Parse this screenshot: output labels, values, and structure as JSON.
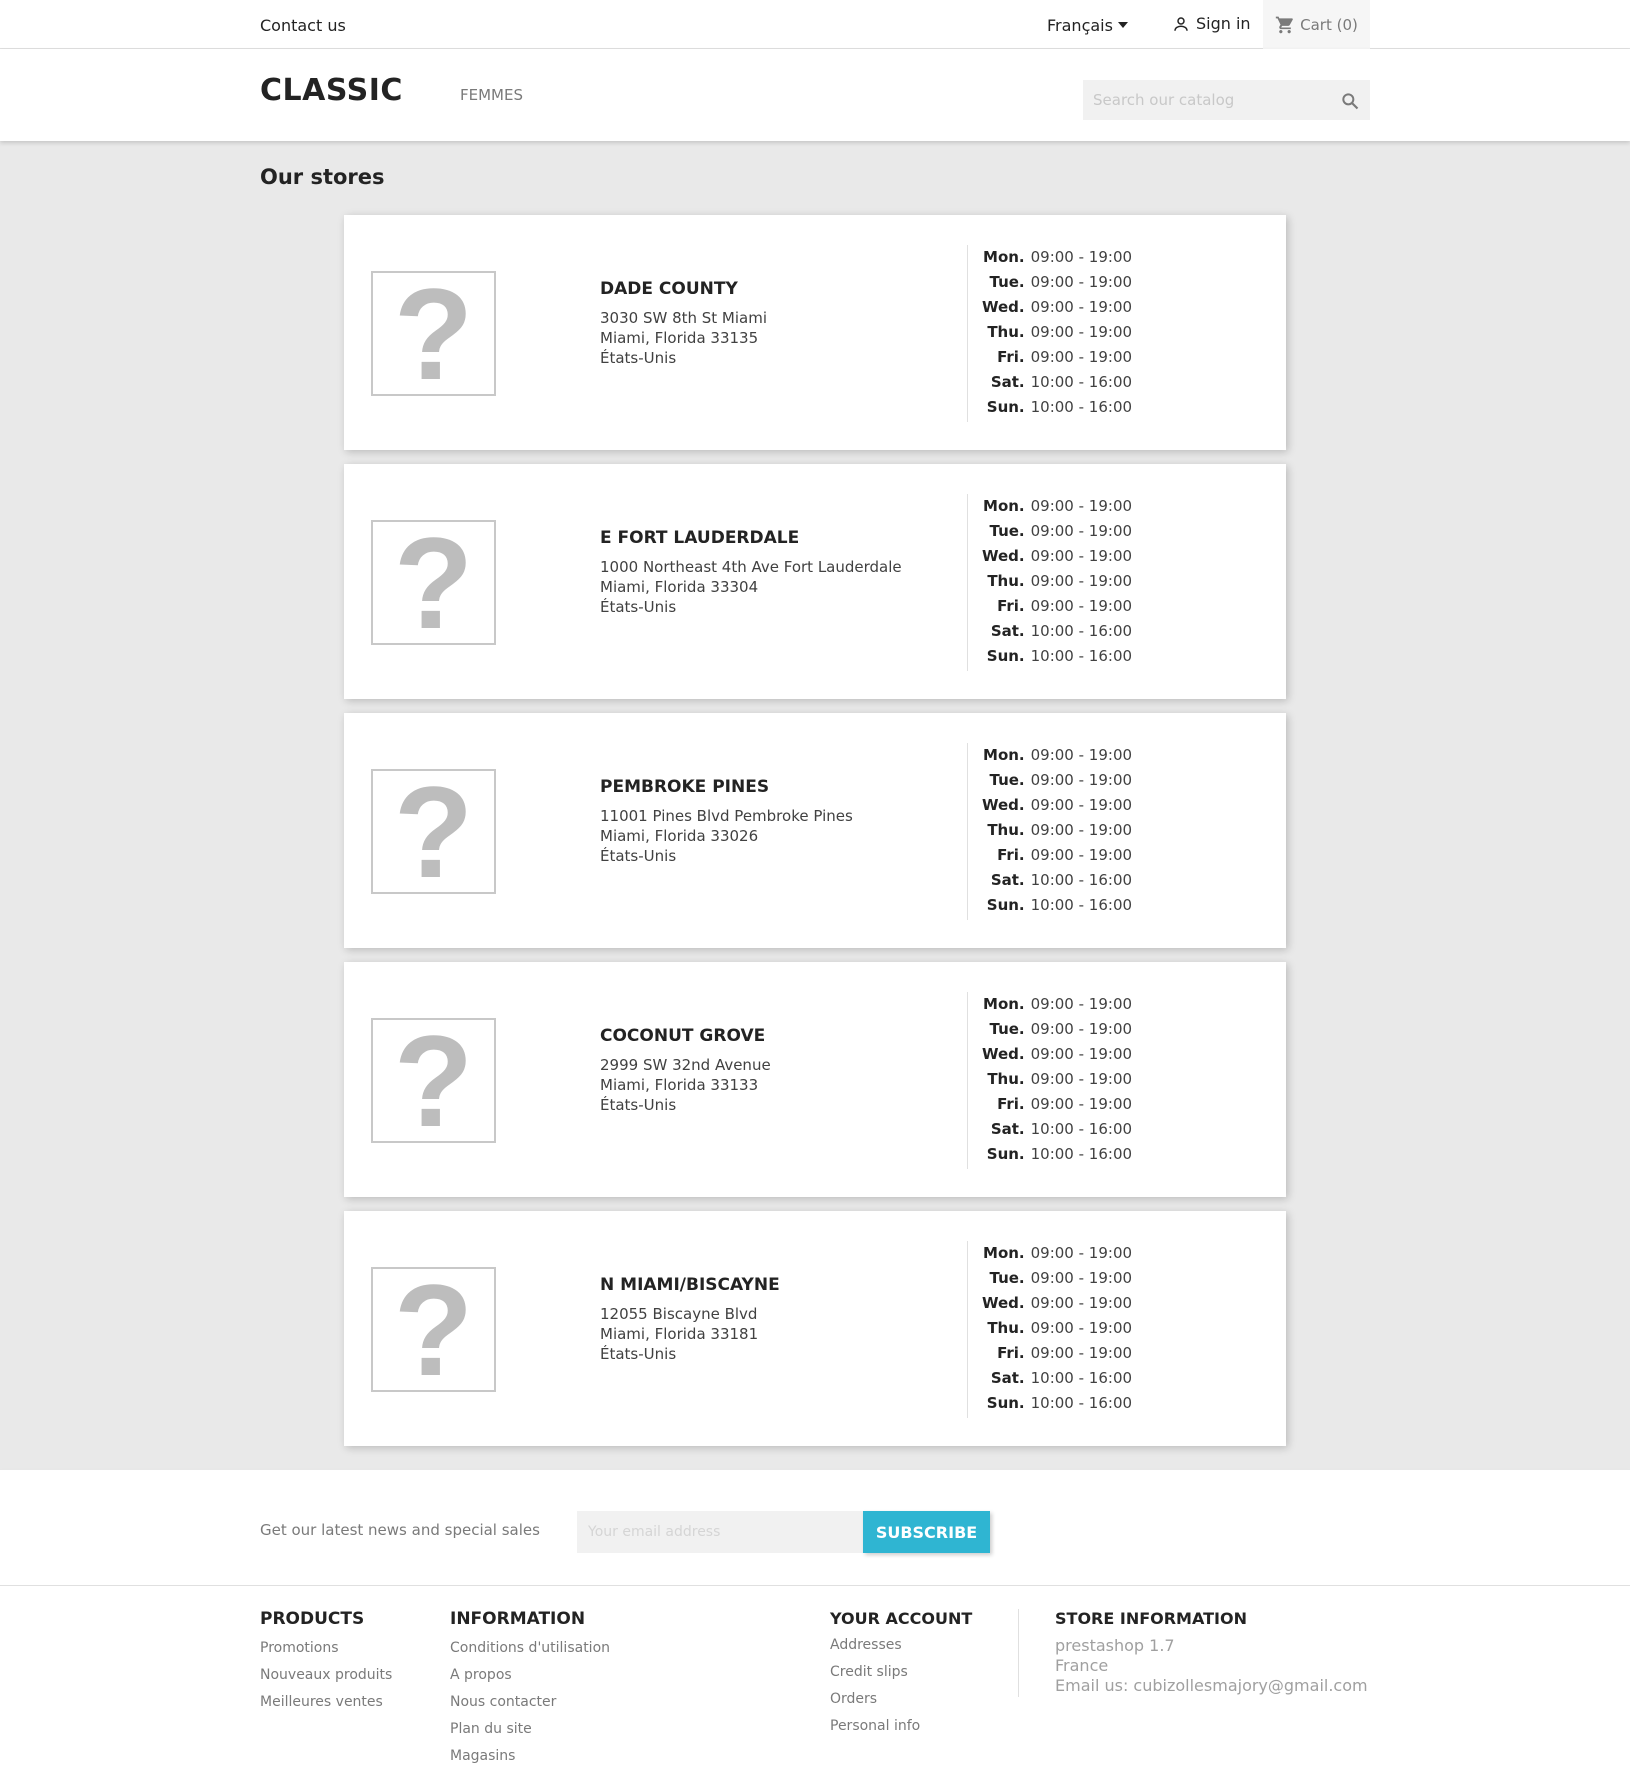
{
  "topnav": {
    "contact": "Contact us",
    "language": "Français",
    "signin": "Sign in",
    "cart": "Cart (0)"
  },
  "header": {
    "logo": "CLASSIC",
    "menu_femmes": "FEMMES",
    "search_placeholder": "Search our catalog"
  },
  "page": {
    "title": "Our stores"
  },
  "stores": [
    {
      "name": "DADE COUNTY",
      "address": [
        "3030 SW 8th St Miami",
        "Miami, Florida 33135",
        "États-Unis"
      ],
      "hours": [
        {
          "day": "Mon.",
          "time": "09:00 - 19:00"
        },
        {
          "day": "Tue.",
          "time": "09:00 - 19:00"
        },
        {
          "day": "Wed.",
          "time": "09:00 - 19:00"
        },
        {
          "day": "Thu.",
          "time": "09:00 - 19:00"
        },
        {
          "day": "Fri.",
          "time": "09:00 - 19:00"
        },
        {
          "day": "Sat.",
          "time": "10:00 - 16:00"
        },
        {
          "day": "Sun.",
          "time": "10:00 - 16:00"
        }
      ]
    },
    {
      "name": "E FORT LAUDERDALE",
      "address": [
        "1000 Northeast 4th Ave Fort Lauderdale",
        "Miami, Florida 33304",
        "États-Unis"
      ],
      "hours": [
        {
          "day": "Mon.",
          "time": "09:00 - 19:00"
        },
        {
          "day": "Tue.",
          "time": "09:00 - 19:00"
        },
        {
          "day": "Wed.",
          "time": "09:00 - 19:00"
        },
        {
          "day": "Thu.",
          "time": "09:00 - 19:00"
        },
        {
          "day": "Fri.",
          "time": "09:00 - 19:00"
        },
        {
          "day": "Sat.",
          "time": "10:00 - 16:00"
        },
        {
          "day": "Sun.",
          "time": "10:00 - 16:00"
        }
      ]
    },
    {
      "name": "PEMBROKE PINES",
      "address": [
        "11001 Pines Blvd Pembroke Pines",
        "Miami, Florida 33026",
        "États-Unis"
      ],
      "hours": [
        {
          "day": "Mon.",
          "time": "09:00 - 19:00"
        },
        {
          "day": "Tue.",
          "time": "09:00 - 19:00"
        },
        {
          "day": "Wed.",
          "time": "09:00 - 19:00"
        },
        {
          "day": "Thu.",
          "time": "09:00 - 19:00"
        },
        {
          "day": "Fri.",
          "time": "09:00 - 19:00"
        },
        {
          "day": "Sat.",
          "time": "10:00 - 16:00"
        },
        {
          "day": "Sun.",
          "time": "10:00 - 16:00"
        }
      ]
    },
    {
      "name": "COCONUT GROVE",
      "address": [
        "2999 SW 32nd Avenue",
        "Miami, Florida 33133",
        "États-Unis"
      ],
      "hours": [
        {
          "day": "Mon.",
          "time": "09:00 - 19:00"
        },
        {
          "day": "Tue.",
          "time": "09:00 - 19:00"
        },
        {
          "day": "Wed.",
          "time": "09:00 - 19:00"
        },
        {
          "day": "Thu.",
          "time": "09:00 - 19:00"
        },
        {
          "day": "Fri.",
          "time": "09:00 - 19:00"
        },
        {
          "day": "Sat.",
          "time": "10:00 - 16:00"
        },
        {
          "day": "Sun.",
          "time": "10:00 - 16:00"
        }
      ]
    },
    {
      "name": "N MIAMI/BISCAYNE",
      "address": [
        "12055 Biscayne Blvd",
        "Miami, Florida 33181",
        "États-Unis"
      ],
      "hours": [
        {
          "day": "Mon.",
          "time": "09:00 - 19:00"
        },
        {
          "day": "Tue.",
          "time": "09:00 - 19:00"
        },
        {
          "day": "Wed.",
          "time": "09:00 - 19:00"
        },
        {
          "day": "Thu.",
          "time": "09:00 - 19:00"
        },
        {
          "day": "Fri.",
          "time": "09:00 - 19:00"
        },
        {
          "day": "Sat.",
          "time": "10:00 - 16:00"
        },
        {
          "day": "Sun.",
          "time": "10:00 - 16:00"
        }
      ]
    }
  ],
  "placeholder_glyph": "?",
  "newsletter": {
    "text": "Get our latest news and special sales",
    "email_placeholder": "Your email address",
    "subscribe": "SUBSCRIBE",
    "accent_color": "#2fb5d2"
  },
  "footer": {
    "products": {
      "title": "PRODUCTS",
      "links": [
        "Promotions",
        "Nouveaux produits",
        "Meilleures ventes"
      ]
    },
    "information": {
      "title": "INFORMATION",
      "links": [
        "Conditions d'utilisation",
        "A propos",
        "Nous contacter",
        "Plan du site",
        "Magasins"
      ]
    },
    "account": {
      "title": "YOUR ACCOUNT",
      "links": [
        "Addresses",
        "Credit slips",
        "Orders",
        "Personal info"
      ]
    },
    "store_info": {
      "title": "STORE INFORMATION",
      "lines": [
        "prestashop 1.7",
        "France",
        "Email us: cubizollesmajory@gmail.com"
      ]
    }
  },
  "icons": {
    "user": "user-icon",
    "cart": "cart-icon",
    "search": "search-icon",
    "caret": "caret-down-icon",
    "image_placeholder": "image-placeholder-icon"
  }
}
